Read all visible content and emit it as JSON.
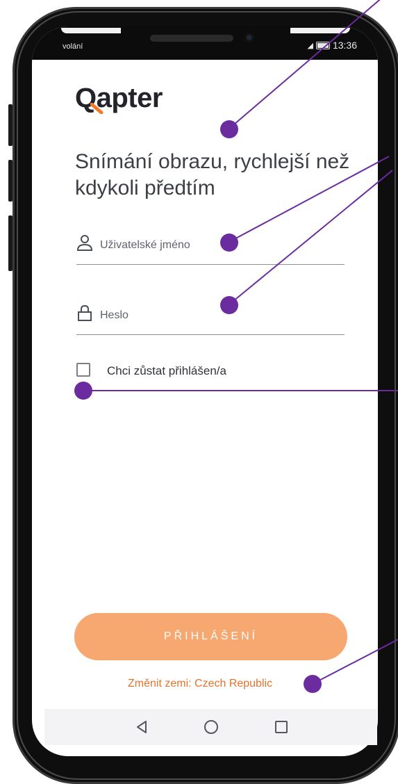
{
  "status_bar": {
    "carrier": "volání",
    "time": "13:36"
  },
  "brand": {
    "logo_text": "Qapter",
    "accent_color": "#f07a2a"
  },
  "headline": "Snímání obrazu, rychlejší než kdykoli předtím",
  "form": {
    "username_placeholder": "Uživatelské jméno",
    "password_placeholder": "Heslo",
    "remember_label": "Chci zůstat přihlášen/a",
    "remember_checked": false
  },
  "login_button": {
    "label": "PŘIHLÁŠENÍ",
    "color": "#f6a870"
  },
  "country_link": {
    "label": "Změnit zemi: Czech Republic",
    "color": "#e8722a"
  },
  "nav_bar": {
    "icons": [
      "back-triangle-icon",
      "home-circle-icon",
      "recents-square-icon"
    ]
  },
  "annotation_color": "#6a2c9e"
}
